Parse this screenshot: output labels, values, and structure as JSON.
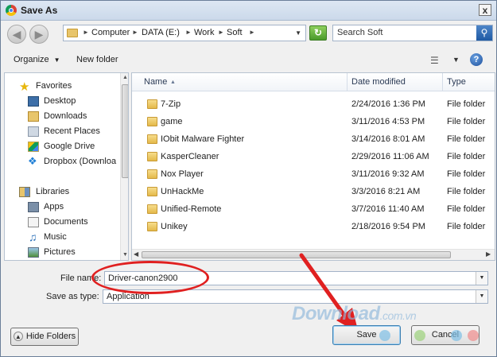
{
  "window": {
    "title": "Save As",
    "close_glyph": "x"
  },
  "address": {
    "crumbs": [
      "Computer",
      "DATA (E:)",
      "Work",
      "Soft"
    ],
    "search_placeholder": "Search Soft"
  },
  "toolbar": {
    "organize_label": "Organize",
    "new_folder_label": "New folder"
  },
  "nav": {
    "favorites": "Favorites",
    "favorite_items": [
      "Desktop",
      "Downloads",
      "Recent Places",
      "Google Drive",
      "Dropbox (Downloa"
    ],
    "libraries": "Libraries",
    "library_items": [
      "Apps",
      "Documents",
      "Music",
      "Pictures"
    ]
  },
  "list": {
    "columns": [
      "Name",
      "Date modified",
      "Type"
    ],
    "rows": [
      {
        "name": "7-Zip",
        "date": "2/24/2016 1:36 PM",
        "type": "File folder"
      },
      {
        "name": "game",
        "date": "3/11/2016 4:53 PM",
        "type": "File folder"
      },
      {
        "name": "IObit Malware Fighter",
        "date": "3/14/2016 8:01 AM",
        "type": "File folder"
      },
      {
        "name": "KasperCleaner",
        "date": "2/29/2016 11:06 AM",
        "type": "File folder"
      },
      {
        "name": "Nox Player",
        "date": "3/11/2016 9:32 AM",
        "type": "File folder"
      },
      {
        "name": "UnHackMe",
        "date": "3/3/2016 8:21 AM",
        "type": "File folder"
      },
      {
        "name": "Unified-Remote",
        "date": "3/7/2016 11:40 AM",
        "type": "File folder"
      },
      {
        "name": "Unikey",
        "date": "2/18/2016 9:54 PM",
        "type": "File folder"
      }
    ]
  },
  "form": {
    "file_name_label": "File name:",
    "file_name_value": "Driver-canon2900",
    "save_type_label": "Save as type:",
    "save_type_value": "Application"
  },
  "buttons": {
    "hide_folders": "Hide Folders",
    "save": "Save",
    "cancel": "Cancel"
  },
  "watermark": {
    "text": "Download",
    "suffix": ".com.vn"
  },
  "colors": {
    "annotation_red": "#e02020",
    "accent_blue": "#1f5aa3"
  }
}
